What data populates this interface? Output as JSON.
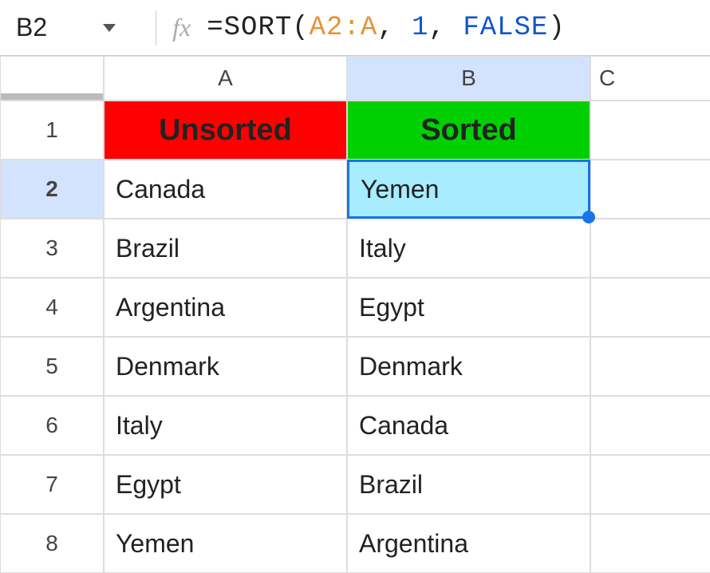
{
  "formula_bar": {
    "cell_reference": "B2",
    "fx_label": "fx",
    "formula_prefix": "=SORT(",
    "formula_range": "A2:A",
    "formula_sep1": ", ",
    "formula_num": "1",
    "formula_sep2": ", ",
    "formula_bool": "FALSE",
    "formula_suffix": ")"
  },
  "columns": {
    "A": "A",
    "B": "B",
    "C": "C"
  },
  "row_headers": [
    "1",
    "2",
    "3",
    "4",
    "5",
    "6",
    "7",
    "8"
  ],
  "headers": {
    "unsorted": "Unsorted",
    "sorted": "Sorted"
  },
  "data": {
    "unsorted": [
      "Canada",
      "Brazil",
      "Argentina",
      "Denmark",
      "Italy",
      "Egypt",
      "Yemen"
    ],
    "sorted": [
      "Yemen",
      "Italy",
      "Egypt",
      "Denmark",
      "Canada",
      "Brazil",
      "Argentina"
    ]
  }
}
